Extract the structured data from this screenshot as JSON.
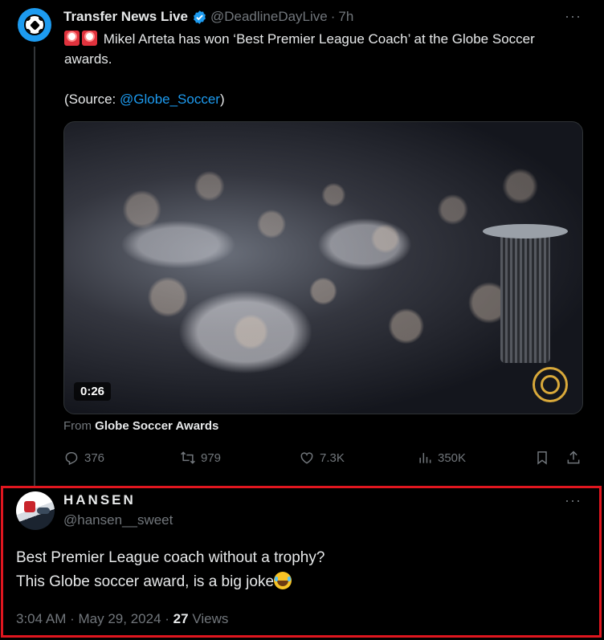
{
  "tweet": {
    "display_name": "Transfer News Live",
    "handle": "@DeadlineDayLive",
    "separator": "·",
    "time": "7h",
    "more": "···",
    "text_line1": " Mikel Arteta has won ‘Best Premier League Coach’ at the Globe Soccer awards.",
    "source_prefix": "(Source: ",
    "source_mention": "@Globe_Soccer",
    "source_suffix": ")",
    "video_duration": "0:26",
    "from_prefix": "From ",
    "from_name": "Globe Soccer Awards",
    "replies": "376",
    "retweets": "979",
    "likes": "7.3K",
    "views": "350K"
  },
  "reply": {
    "display_name": "HANSEN",
    "handle": "@hansen__sweet",
    "more": "···",
    "line1": "Best Premier League coach without a trophy?",
    "line2": "This Globe soccer award, is a big joke",
    "time": "3:04 AM",
    "separator": "·",
    "date": "May 29, 2024",
    "views_count": "27",
    "views_label": " Views"
  },
  "colors": {
    "background": "#000000",
    "text": "#e7e9ea",
    "muted": "#71767b",
    "link": "#1d9bf0",
    "highlight_border": "#e0161f"
  },
  "icons": [
    "soccer-ball-icon",
    "verified-badge-icon",
    "siren-icon",
    "reply-icon",
    "retweet-icon",
    "like-icon",
    "views-icon",
    "bookmark-icon",
    "share-icon",
    "laughing-tears-emoji"
  ]
}
